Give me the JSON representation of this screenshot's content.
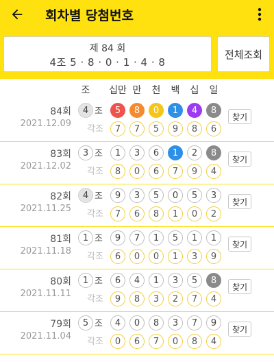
{
  "appbar": {
    "title": "회차별 당첨번호",
    "back_icon": "arrow-left-icon",
    "menu_icon": "more-vertical-icon"
  },
  "summary": {
    "line1": "제 84 회",
    "line2": "4조  5 · 8 · 0 · 1 · 4 · 8"
  },
  "view_all_label": "전체조회",
  "columns": [
    "조",
    "십만",
    "만",
    "천",
    "백",
    "십",
    "일"
  ],
  "jo_suffix": "조",
  "gakjo_label": "각조",
  "find_label": "찾기",
  "colors": {
    "brand_yellow": "#FFE10F",
    "ball_red": "#F0524C",
    "ball_orange": "#F58B2E",
    "ball_yellow": "#F5C518",
    "ball_blue": "#2E8FE6",
    "ball_purple": "#9B3CF0",
    "ball_gray": "#8A8A8A"
  },
  "draws": [
    {
      "round": "84회",
      "date": "2021.12.09",
      "jo": "4",
      "jo_highlight": true,
      "digits": [
        {
          "v": "5",
          "color": "red"
        },
        {
          "v": "8",
          "color": "orange"
        },
        {
          "v": "0",
          "color": "yellow"
        },
        {
          "v": "1",
          "color": "blue"
        },
        {
          "v": "4",
          "color": "purple"
        },
        {
          "v": "8",
          "color": "gray"
        }
      ],
      "sub": [
        "7",
        "7",
        "5",
        "9",
        "8",
        "6"
      ]
    },
    {
      "round": "83회",
      "date": "2021.12.02",
      "jo": "3",
      "jo_highlight": false,
      "digits": [
        {
          "v": "1",
          "color": ""
        },
        {
          "v": "3",
          "color": ""
        },
        {
          "v": "6",
          "color": ""
        },
        {
          "v": "1",
          "color": "blue"
        },
        {
          "v": "2",
          "color": ""
        },
        {
          "v": "8",
          "color": "gray"
        }
      ],
      "sub": [
        "8",
        "0",
        "6",
        "7",
        "9",
        "4"
      ]
    },
    {
      "round": "82회",
      "date": "2021.11.25",
      "jo": "4",
      "jo_highlight": true,
      "digits": [
        {
          "v": "9",
          "color": ""
        },
        {
          "v": "3",
          "color": ""
        },
        {
          "v": "5",
          "color": ""
        },
        {
          "v": "0",
          "color": ""
        },
        {
          "v": "5",
          "color": ""
        },
        {
          "v": "3",
          "color": ""
        }
      ],
      "sub": [
        "7",
        "6",
        "8",
        "1",
        "0",
        "2"
      ]
    },
    {
      "round": "81회",
      "date": "2021.11.18",
      "jo": "1",
      "jo_highlight": false,
      "digits": [
        {
          "v": "9",
          "color": ""
        },
        {
          "v": "7",
          "color": ""
        },
        {
          "v": "1",
          "color": ""
        },
        {
          "v": "5",
          "color": ""
        },
        {
          "v": "1",
          "color": ""
        },
        {
          "v": "1",
          "color": ""
        }
      ],
      "sub": [
        "6",
        "0",
        "0",
        "1",
        "3",
        "9"
      ]
    },
    {
      "round": "80회",
      "date": "2021.11.11",
      "jo": "1",
      "jo_highlight": false,
      "digits": [
        {
          "v": "6",
          "color": ""
        },
        {
          "v": "4",
          "color": ""
        },
        {
          "v": "1",
          "color": ""
        },
        {
          "v": "3",
          "color": ""
        },
        {
          "v": "5",
          "color": ""
        },
        {
          "v": "8",
          "color": "gray"
        }
      ],
      "sub": [
        "9",
        "8",
        "3",
        "2",
        "7",
        "4"
      ]
    },
    {
      "round": "79회",
      "date": "2021.11.04",
      "jo": "5",
      "jo_highlight": false,
      "digits": [
        {
          "v": "4",
          "color": ""
        },
        {
          "v": "0",
          "color": ""
        },
        {
          "v": "8",
          "color": ""
        },
        {
          "v": "3",
          "color": ""
        },
        {
          "v": "7",
          "color": ""
        },
        {
          "v": "9",
          "color": ""
        }
      ],
      "sub": [
        "0",
        "6",
        "7",
        "0",
        "8",
        "4"
      ]
    }
  ]
}
